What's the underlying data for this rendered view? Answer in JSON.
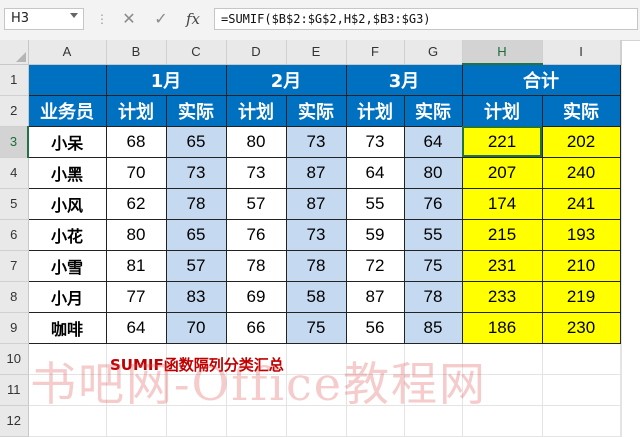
{
  "formula_bar": {
    "name_box": "H3",
    "sep": "⋮",
    "cancel_glyph": "✕",
    "confirm_glyph": "✓",
    "fx_label": "fx",
    "formula": "=SUMIF($B$2:$G$2,H$2,$B3:$G3)"
  },
  "columns": [
    "A",
    "B",
    "C",
    "D",
    "E",
    "F",
    "G",
    "H",
    "I"
  ],
  "rows": [
    "1",
    "2",
    "3",
    "4",
    "5",
    "6",
    "7",
    "8",
    "9",
    "10",
    "11",
    "12"
  ],
  "selection": {
    "cell": "H3",
    "column": "H",
    "row": "3"
  },
  "header1": {
    "m1": "1月",
    "m2": "2月",
    "m3": "3月",
    "total": "合计"
  },
  "header2": [
    "业务员",
    "计划",
    "实际",
    "计划",
    "实际",
    "计划",
    "实际",
    "计划",
    "实际"
  ],
  "data": [
    [
      "小呆",
      68,
      65,
      80,
      73,
      73,
      64,
      221,
      202
    ],
    [
      "小黑",
      70,
      73,
      73,
      87,
      64,
      80,
      207,
      240
    ],
    [
      "小风",
      62,
      78,
      57,
      87,
      55,
      76,
      174,
      241
    ],
    [
      "小花",
      80,
      65,
      76,
      73,
      59,
      55,
      215,
      193
    ],
    [
      "小雪",
      81,
      57,
      78,
      78,
      72,
      75,
      231,
      210
    ],
    [
      "小月",
      77,
      83,
      69,
      58,
      87,
      78,
      233,
      219
    ],
    [
      "咖啡",
      64,
      70,
      66,
      75,
      56,
      85,
      186,
      230
    ]
  ],
  "note": "SUMIF函数隔列分类汇总",
  "watermark": "书吧网-Office教程网",
  "colors": {
    "header_blue": "#0070c0",
    "actual_blue": "#c5d9f1",
    "total_yellow": "#ffff00",
    "note_red": "#c00000",
    "selection_green": "#217346"
  }
}
